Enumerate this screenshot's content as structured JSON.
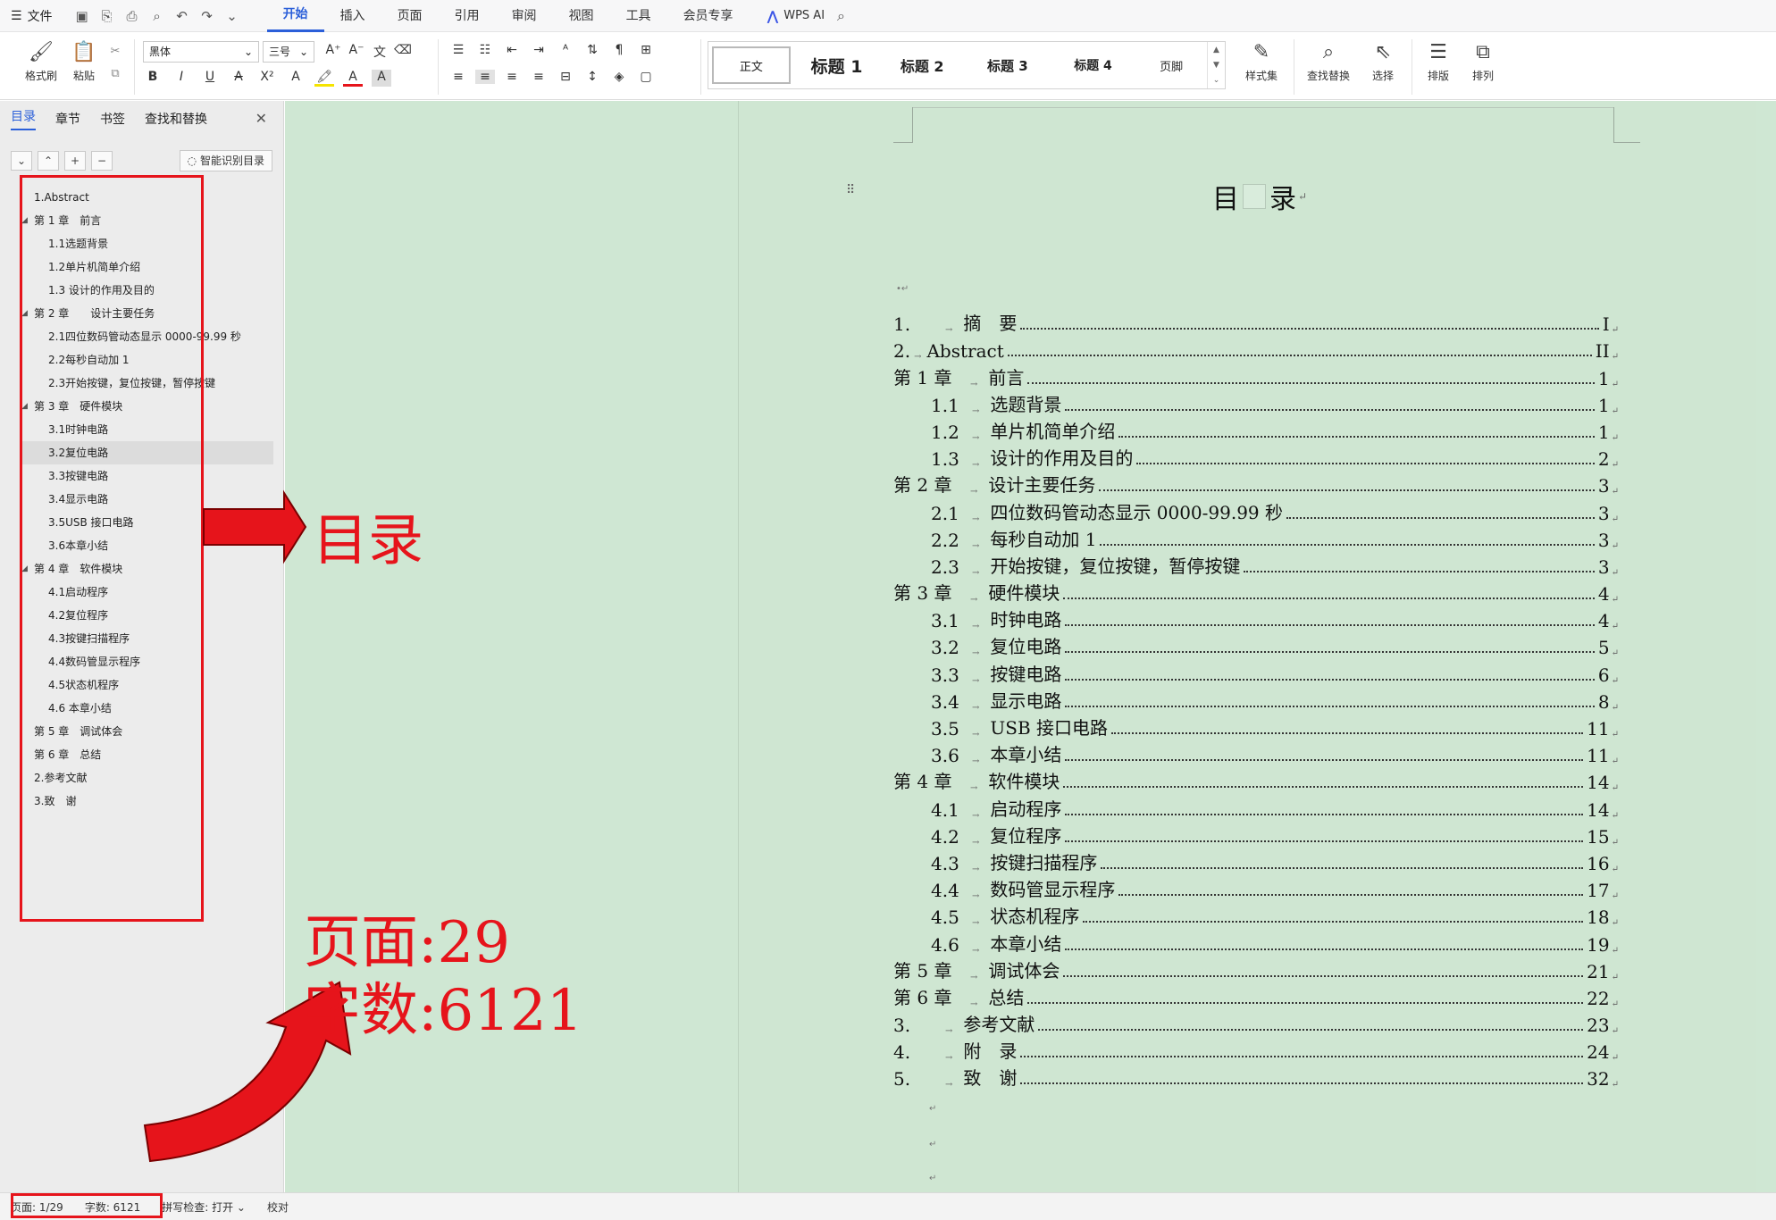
{
  "menubar": {
    "file_label": "文件",
    "tabs": [
      "开始",
      "插入",
      "页面",
      "引用",
      "审阅",
      "视图",
      "工具",
      "会员专享"
    ],
    "active_tab": "开始",
    "wps_ai_label": "WPS AI"
  },
  "ribbon": {
    "format_painter": "格式刷",
    "paste": "粘贴",
    "font_name": "黑体",
    "font_size": "三号",
    "styles": {
      "normal": "正文",
      "h1": "标题 1",
      "h2": "标题 2",
      "h3": "标题 3",
      "h4": "标题 4",
      "footer": "页脚"
    },
    "style_set": "样式集",
    "find_replace": "查找替换",
    "select": "选择",
    "layout": "排版",
    "arrange": "排列"
  },
  "left_panel": {
    "tabs": [
      "目录",
      "章节",
      "书签",
      "查找和替换"
    ],
    "active_tab": "目录",
    "smart_toc_button": "智能识别目录",
    "toc_items": [
      {
        "label": "1.Abstract",
        "level": 1
      },
      {
        "label": "第 1 章　前言",
        "level": 1,
        "expanded": true
      },
      {
        "label": "1.1选题背景",
        "level": 2
      },
      {
        "label": "1.2单片机简单介绍",
        "level": 2
      },
      {
        "label": "1.3 设计的作用及目的",
        "level": 2
      },
      {
        "label": "第 2 章　　设计主要任务",
        "level": 1,
        "expanded": true
      },
      {
        "label": "2.1四位数码管动态显示 0000-99.99 秒",
        "level": 2
      },
      {
        "label": "2.2每秒自动加 1",
        "level": 2
      },
      {
        "label": "2.3开始按键，复位按键，暂停按键",
        "level": 2
      },
      {
        "label": "第 3 章　硬件模块",
        "level": 1,
        "expanded": true
      },
      {
        "label": "3.1时钟电路",
        "level": 2
      },
      {
        "label": "3.2复位电路",
        "level": 2,
        "selected": true
      },
      {
        "label": "3.3按键电路",
        "level": 2
      },
      {
        "label": "3.4显示电路",
        "level": 2
      },
      {
        "label": "3.5USB 接口电路",
        "level": 2
      },
      {
        "label": "3.6本章小结",
        "level": 2
      },
      {
        "label": "第 4 章　软件模块",
        "level": 1,
        "expanded": true
      },
      {
        "label": "4.1启动程序",
        "level": 2
      },
      {
        "label": "4.2复位程序",
        "level": 2
      },
      {
        "label": "4.3按键扫描程序",
        "level": 2
      },
      {
        "label": "4.4数码管显示程序",
        "level": 2
      },
      {
        "label": "4.5状态机程序",
        "level": 2
      },
      {
        "label": "4.6 本章小结",
        "level": 2
      },
      {
        "label": "第 5 章　调试体会",
        "level": 1
      },
      {
        "label": "第 6 章　总结",
        "level": 1
      },
      {
        "label": "2.参考文献",
        "level": 1
      },
      {
        "label": "3.致　谢",
        "level": 1
      }
    ]
  },
  "document": {
    "title_a": "目",
    "title_b": "录",
    "toc": [
      {
        "num": "1.",
        "text": "摘　要",
        "page": "I",
        "kind": "top"
      },
      {
        "num": "2.",
        "text": "Abstract",
        "page": "II",
        "kind": "top2"
      },
      {
        "num": "第 1 章",
        "text": "前言",
        "page": "1",
        "kind": "chapter"
      },
      {
        "num": "1.1",
        "text": "选题背景",
        "page": "1",
        "kind": "sub"
      },
      {
        "num": "1.2",
        "text": "单片机简单介绍",
        "page": "1",
        "kind": "sub"
      },
      {
        "num": "1.3",
        "text": "设计的作用及目的",
        "page": "2",
        "kind": "sub"
      },
      {
        "num": "第 2 章",
        "text": "设计主要任务",
        "page": "3",
        "kind": "chapter"
      },
      {
        "num": "2.1",
        "text": "四位数码管动态显示 0000-99.99 秒",
        "page": "3",
        "kind": "sub"
      },
      {
        "num": "2.2",
        "text": "每秒自动加 1",
        "page": "3",
        "kind": "sub"
      },
      {
        "num": "2.3",
        "text": "开始按键，复位按键，暂停按键",
        "page": "3",
        "kind": "sub"
      },
      {
        "num": "第 3 章",
        "text": "硬件模块",
        "page": "4",
        "kind": "chapter"
      },
      {
        "num": "3.1",
        "text": "时钟电路",
        "page": "4",
        "kind": "sub"
      },
      {
        "num": "3.2",
        "text": "复位电路",
        "page": "5",
        "kind": "sub"
      },
      {
        "num": "3.3",
        "text": "按键电路",
        "page": "6",
        "kind": "sub"
      },
      {
        "num": "3.4",
        "text": "显示电路",
        "page": "8",
        "kind": "sub"
      },
      {
        "num": "3.5",
        "text": "USB 接口电路",
        "page": "11",
        "kind": "sub"
      },
      {
        "num": "3.6",
        "text": "本章小结",
        "page": "11",
        "kind": "sub"
      },
      {
        "num": "第 4 章",
        "text": "软件模块",
        "page": "14",
        "kind": "chapter"
      },
      {
        "num": "4.1",
        "text": "启动程序",
        "page": "14",
        "kind": "sub"
      },
      {
        "num": "4.2",
        "text": "复位程序",
        "page": "15",
        "kind": "sub"
      },
      {
        "num": "4.3",
        "text": "按键扫描程序",
        "page": "16",
        "kind": "sub"
      },
      {
        "num": "4.4",
        "text": "数码管显示程序",
        "page": "17",
        "kind": "sub"
      },
      {
        "num": "4.5",
        "text": "状态机程序",
        "page": "18",
        "kind": "sub"
      },
      {
        "num": "4.6",
        "text": "本章小结",
        "page": "19",
        "kind": "sub"
      },
      {
        "num": "第 5 章",
        "text": "调试体会",
        "page": "21",
        "kind": "chapter"
      },
      {
        "num": "第 6 章",
        "text": "总结",
        "page": "22",
        "kind": "chapter"
      },
      {
        "num": "3.",
        "text": "参考文献",
        "page": "23",
        "kind": "top"
      },
      {
        "num": "4.",
        "text": "附　录",
        "page": "24",
        "kind": "top"
      },
      {
        "num": "5.",
        "text": "致　谢",
        "page": "32",
        "kind": "top"
      }
    ]
  },
  "annotations": {
    "toc_label": "目录",
    "pages_label": "页面:29",
    "words_label": "字数:6121",
    "color": "#e6141b"
  },
  "statusbar": {
    "page": "页面: 1/29",
    "words": "字数: 6121",
    "spell_check": "拼写检查: 打开 ⌄",
    "proof": "校对"
  }
}
